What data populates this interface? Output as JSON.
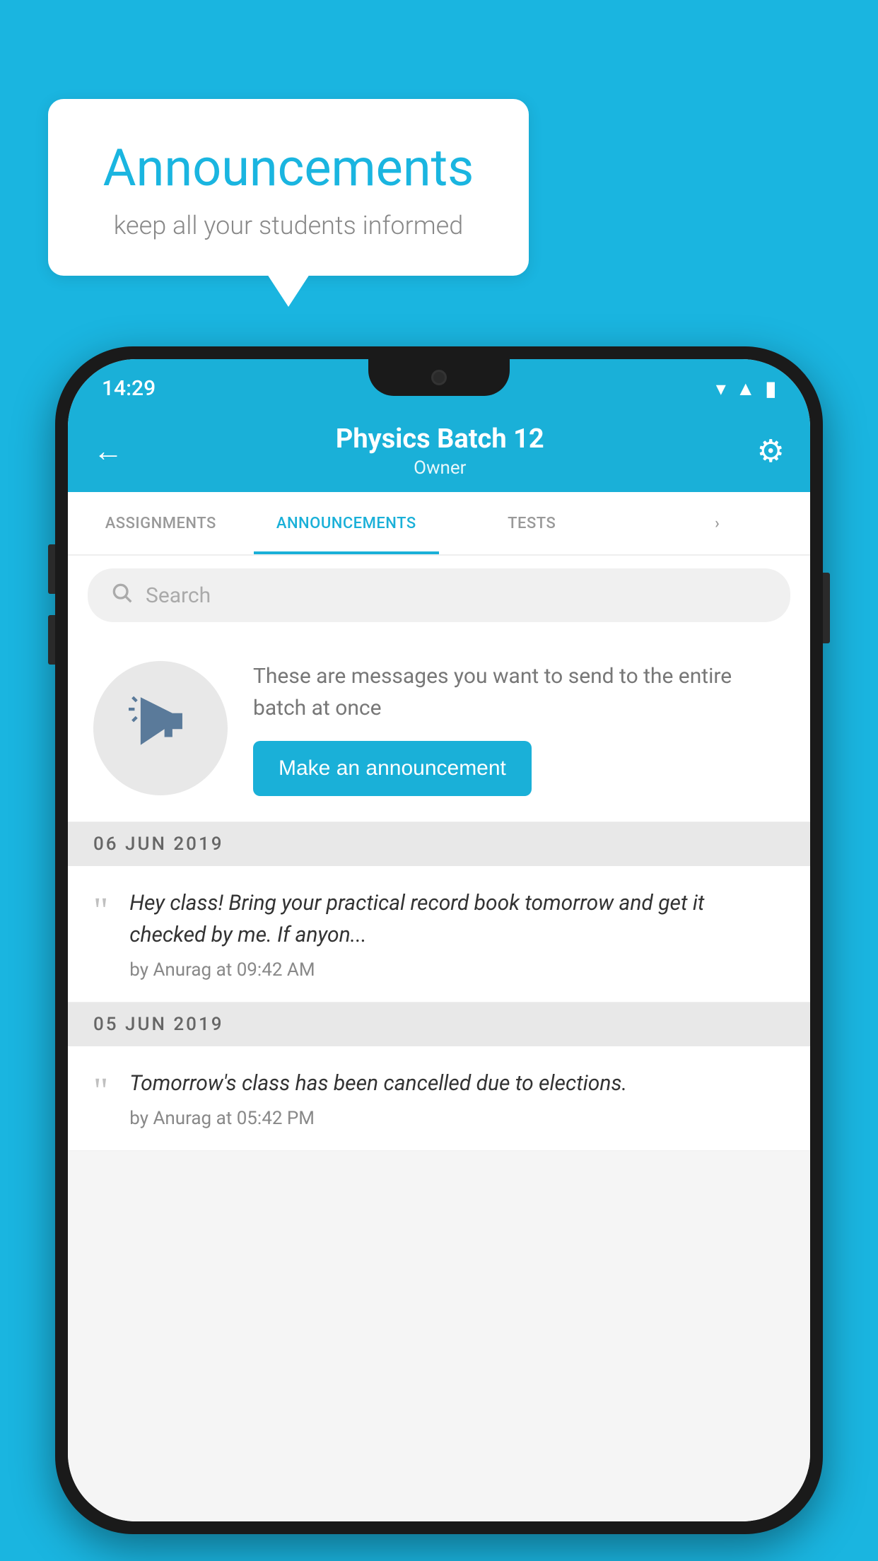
{
  "background_color": "#1ab5e0",
  "speech_bubble": {
    "title": "Announcements",
    "subtitle": "keep all your students informed"
  },
  "phone": {
    "status_bar": {
      "time": "14:29",
      "wifi": "▼▲",
      "signal": "▲",
      "battery": "▮"
    },
    "app_bar": {
      "title": "Physics Batch 12",
      "subtitle": "Owner",
      "back_label": "←",
      "settings_label": "⚙"
    },
    "tabs": [
      {
        "label": "ASSIGNMENTS",
        "active": false
      },
      {
        "label": "ANNOUNCEMENTS",
        "active": true
      },
      {
        "label": "TESTS",
        "active": false
      },
      {
        "label": "›",
        "active": false
      }
    ],
    "search": {
      "placeholder": "Search"
    },
    "promo": {
      "description": "These are messages you want to send to the entire batch at once",
      "button_label": "Make an announcement"
    },
    "announcements": [
      {
        "date": "06  JUN  2019",
        "items": [
          {
            "text": "Hey class! Bring your practical record book tomorrow and get it checked by me. If anyon...",
            "meta": "by Anurag at 09:42 AM"
          }
        ]
      },
      {
        "date": "05  JUN  2019",
        "items": [
          {
            "text": "Tomorrow's class has been cancelled due to elections.",
            "meta": "by Anurag at 05:42 PM"
          }
        ]
      }
    ]
  }
}
